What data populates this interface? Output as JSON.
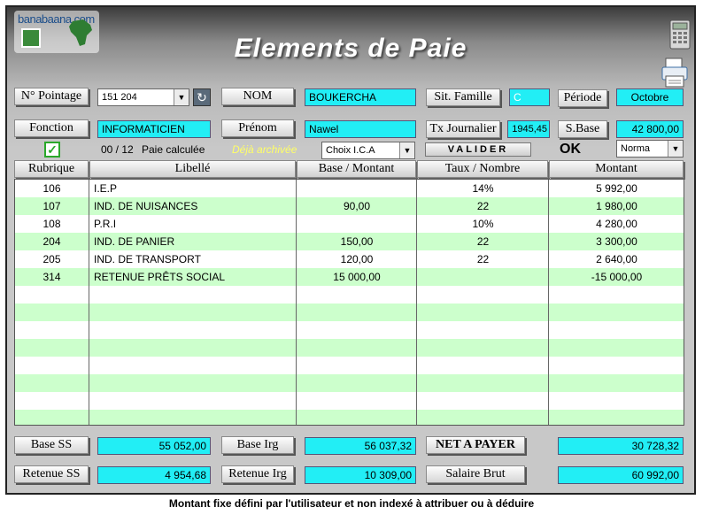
{
  "logo": {
    "text": "banabaana.com"
  },
  "title": "Elements de Paie",
  "header": {
    "pointage_label": "N° Pointage",
    "pointage_value": "151 204",
    "nom_label": "NOM",
    "nom_value": "BOUKERCHA",
    "sit_famille_label": "Sit. Famille",
    "sit_famille_value": "C",
    "periode_label": "Période",
    "periode_value": "Octobre",
    "fonction_label": "Fonction",
    "fonction_value": "INFORMATICIEN",
    "prenom_label": "Prénom",
    "prenom_value": "Nawel",
    "tx_journalier_label": "Tx Journalier",
    "tx_journalier_value": "1945,45",
    "sbase_label": "S.Base",
    "sbase_value": "42 800,00",
    "count_text": "00 / 12",
    "paie_calculee": "Paie calculée",
    "deja_archivee": "Déjà archivée",
    "choix_ica": "Choix I.C.A",
    "valider": "VALIDER",
    "ok": "OK",
    "mode_value": "Norma"
  },
  "grid": {
    "columns": [
      "Rubrique",
      "Libellé",
      "Base / Montant",
      "Taux / Nombre",
      "Montant"
    ],
    "rows": [
      {
        "rubrique": "106",
        "libelle": "I.E.P",
        "base": "",
        "taux": "14%",
        "montant": "5 992,00"
      },
      {
        "rubrique": "107",
        "libelle": "IND. DE NUISANCES",
        "base": "90,00",
        "taux": "22",
        "montant": "1 980,00"
      },
      {
        "rubrique": "108",
        "libelle": "P.R.I",
        "base": "",
        "taux": "10%",
        "montant": "4 280,00"
      },
      {
        "rubrique": "204",
        "libelle": "IND. DE PANIER",
        "base": "150,00",
        "taux": "22",
        "montant": "3 300,00"
      },
      {
        "rubrique": "205",
        "libelle": "IND. DE TRANSPORT",
        "base": "120,00",
        "taux": "22",
        "montant": "2 640,00"
      },
      {
        "rubrique": "314",
        "libelle": "RETENUE PRÊTS SOCIAL",
        "base": "15 000,00",
        "taux": "",
        "montant": "-15 000,00"
      }
    ]
  },
  "totals": {
    "base_ss_label": "Base SS",
    "base_ss_value": "55 052,00",
    "base_irg_label": "Base Irg",
    "base_irg_value": "56 037,32",
    "net_label": "NET A PAYER",
    "net_value": "30 728,32",
    "retenue_ss_label": "Retenue SS",
    "retenue_ss_value": "4 954,68",
    "retenue_irg_label": "Retenue Irg",
    "retenue_irg_value": "10 309,00",
    "salaire_brut_label": "Salaire Brut",
    "salaire_brut_value": "60 992,00"
  },
  "footer_note": "Montant fixe défini par l'utilisateur et non indexé à attribuer ou à déduire",
  "colors": {
    "field": "#22eef5",
    "row_alt": "#ccffcc",
    "archived_text": "#ffff66"
  },
  "icons": [
    "calculator-icon",
    "printer-icon",
    "refresh-icon",
    "checkbox-checked-icon",
    "dropdown-arrow-icon"
  ]
}
